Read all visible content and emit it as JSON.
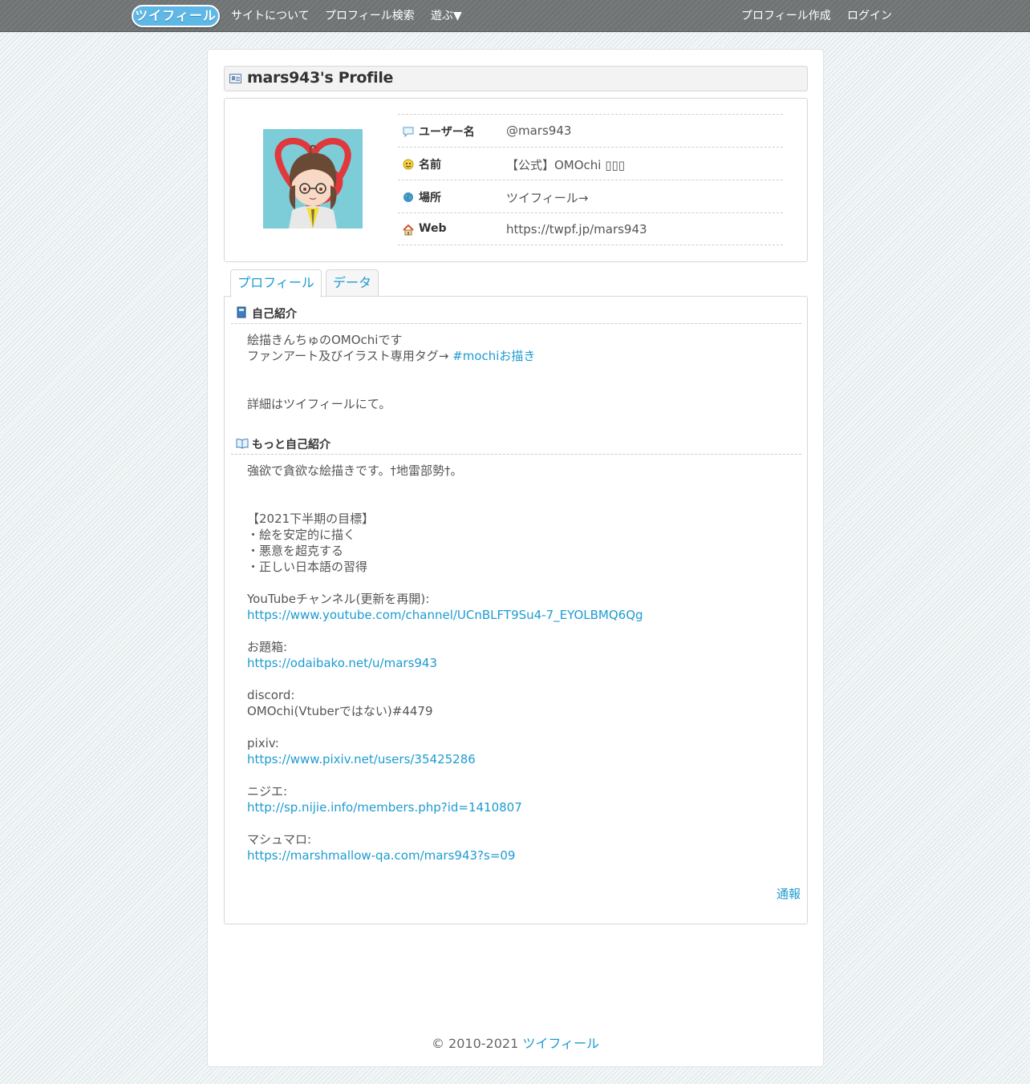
{
  "nav": {
    "logo_text": "ツイフィール",
    "about": "サイトについて",
    "search": "プロフィール検索",
    "play": "遊ぶ▼",
    "create": "プロフィール作成",
    "login": "ログイン"
  },
  "profile": {
    "title": "mars943's Profile",
    "fields": [
      {
        "label": "ユーザー名",
        "value": "@mars943",
        "icon": "speech-bubble-icon"
      },
      {
        "label": "名前",
        "value": "【公式】OMOchi ▯▯▯",
        "icon": "smiley-icon"
      },
      {
        "label": "場所",
        "value": "ツイフィール→",
        "icon": "globe-icon"
      },
      {
        "label": "Web",
        "value": "https://twpf.jp/mars943",
        "icon": "house-icon"
      }
    ]
  },
  "tabs": [
    "プロフィール",
    "データ"
  ],
  "intro": {
    "title": "自己紹介",
    "line1": "絵描きんちゅのOMOchiです",
    "line2_prefix": "ファンアート及びイラスト専用タグ→ ",
    "line2_tag": "#mochiお描き",
    "line3": "詳細はツイフィールにて。"
  },
  "more": {
    "title": "もっと自己紹介",
    "lines": [
      {
        "text": "強欲で貪欲な絵描きです。†地雷部勢†。",
        "link": false
      },
      {
        "text": "",
        "link": false
      },
      {
        "text": "",
        "link": false
      },
      {
        "text": "【2021下半期の目標】",
        "link": false
      },
      {
        "text": "・絵を安定的に描く",
        "link": false
      },
      {
        "text": "・悪意を超克する",
        "link": false
      },
      {
        "text": "・正しい日本語の習得",
        "link": false
      },
      {
        "text": "",
        "link": false
      },
      {
        "text": "YouTubeチャンネル(更新を再開):",
        "link": false
      },
      {
        "text": "https://www.youtube.com/channel/UCnBLFT9Su4-7_EYOLBMQ6Qg",
        "link": true
      },
      {
        "text": "",
        "link": false
      },
      {
        "text": "お題箱:",
        "link": false
      },
      {
        "text": "https://odaibako.net/u/mars943",
        "link": true
      },
      {
        "text": "",
        "link": false
      },
      {
        "text": "discord:",
        "link": false
      },
      {
        "text": "OMOchi(Vtuberではない)#4479",
        "link": false
      },
      {
        "text": "",
        "link": false
      },
      {
        "text": "pixiv:",
        "link": false
      },
      {
        "text": "https://www.pixiv.net/users/35425286",
        "link": true
      },
      {
        "text": "",
        "link": false
      },
      {
        "text": "ニジエ:",
        "link": false
      },
      {
        "text": "http://sp.nijie.info/members.php?id=1410807",
        "link": true
      },
      {
        "text": "",
        "link": false
      },
      {
        "text": "マシュマロ:",
        "link": false
      },
      {
        "text": "https://marshmallow-qa.com/mars943?s=09",
        "link": true
      }
    ]
  },
  "report": "通報",
  "footer": {
    "copyright": "© 2010-2021 ",
    "site_link": "ツイフィール"
  },
  "colors": {
    "link": "#1d9bd1",
    "topbar": "#707374",
    "avatar_bg": "#7dcdd8"
  }
}
